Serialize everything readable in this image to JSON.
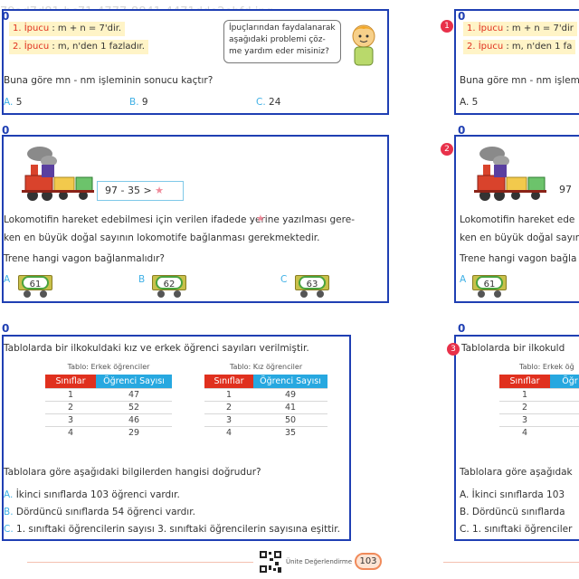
{
  "page": {
    "watermark": "79ad7d81-bc71-4777-8841-4471dde2ebfd.jpg",
    "footer_label": "Ünite Değerlendirme",
    "page_number": "103"
  },
  "q1": {
    "number": "0",
    "hint1_prefix": "1. İpucu",
    "hint1_text": " : m + n = 7'dir.",
    "hint2_prefix": "2. İpucu",
    "hint2_text": " : m, n'den 1 fazladır.",
    "speech": [
      "İpuçlarından faydalanarak",
      "aşağıdaki problemi çöz-",
      "me yardım eder misiniz?"
    ],
    "question": "Buna göre mn - nm işleminin sonucu kaçtır?",
    "options": [
      {
        "letter": "A.",
        "text": "5"
      },
      {
        "letter": "B.",
        "text": "9"
      },
      {
        "letter": "C.",
        "text": "24"
      }
    ]
  },
  "q2": {
    "number": "0",
    "expression": "97 - 35 >",
    "line1": "Lokomotifin hareket edebilmesi için verilen ifadede   yerine yazılması gere-",
    "line2": "ken en büyük doğal sayının lokomotife bağlanması gerekmektedir.",
    "question": "Trene hangi vagon bağlanmalıdır?",
    "options": [
      {
        "letter": "A",
        "value": "61"
      },
      {
        "letter": "B",
        "value": "62"
      },
      {
        "letter": "C",
        "value": "63"
      }
    ]
  },
  "q3": {
    "number": "0",
    "intro": "Tablolarda bir ilkokuldaki kız ve erkek öğrenci sayıları verilmiştir.",
    "table1": {
      "caption": "Tablo: Erkek öğrenciler",
      "headers": [
        "Sınıflar",
        "Öğrenci Sayısı"
      ],
      "rows": [
        [
          "1",
          "47"
        ],
        [
          "2",
          "52"
        ],
        [
          "3",
          "46"
        ],
        [
          "4",
          "29"
        ]
      ]
    },
    "table2": {
      "caption": "Tablo: Kız öğrenciler",
      "headers": [
        "Sınıflar",
        "Öğrenci Sayısı"
      ],
      "rows": [
        [
          "1",
          "49"
        ],
        [
          "2",
          "41"
        ],
        [
          "3",
          "50"
        ],
        [
          "4",
          "35"
        ]
      ]
    },
    "question": "Tablolara göre aşağıdaki bilgilerden hangisi doğrudur?",
    "options": [
      {
        "letter": "A.",
        "text": "İkinci sınıflarda 103 öğrenci vardır."
      },
      {
        "letter": "B.",
        "text": "Dördüncü sınıflarda 54 öğrenci vardır."
      },
      {
        "letter": "C.",
        "text": "1. sınıftaki öğrencilerin sayısı 3. sınıftaki öğrencilerin sayısına eşittir."
      }
    ]
  },
  "right_page": {
    "q1": {
      "badge": "1",
      "number": "0",
      "hint1_prefix": "1. İpucu",
      "hint1_text": " : m + n = 7'dir",
      "hint2_prefix": "2. İpucu",
      "hint2_text": " : m, n'den 1 fa",
      "question": "Buna göre mn - nm işlemin",
      "optA": "A. 5"
    },
    "q2": {
      "badge": "2",
      "number": "0",
      "expr": "97",
      "line1": "Lokomotifin hareket ede",
      "line2": "ken en büyük doğal sayın",
      "question": "Trene hangi vagon bağla",
      "optA": "61"
    },
    "q3": {
      "badge": "3",
      "number": "0",
      "intro": "Tablolarda bir ilkokuld",
      "caption": "Tablo: Erkek öğ",
      "hdr": "Sınıflar",
      "hdr2": "Öğr",
      "rows": [
        "1",
        "2",
        "3",
        "4"
      ],
      "question": "Tablolara göre aşağıdak",
      "optA": "A. İkinci sınıflarda 103",
      "optB": "B. Dördüncü sınıflarda",
      "optC": "C. 1. sınıftaki öğrenciler"
    }
  },
  "colors": {
    "frame": "#1f3fb3",
    "accent": "#3fb0e6",
    "hint": "#e0301e",
    "table1_header": "#e0301e",
    "table2_header": "#27a8e0"
  }
}
